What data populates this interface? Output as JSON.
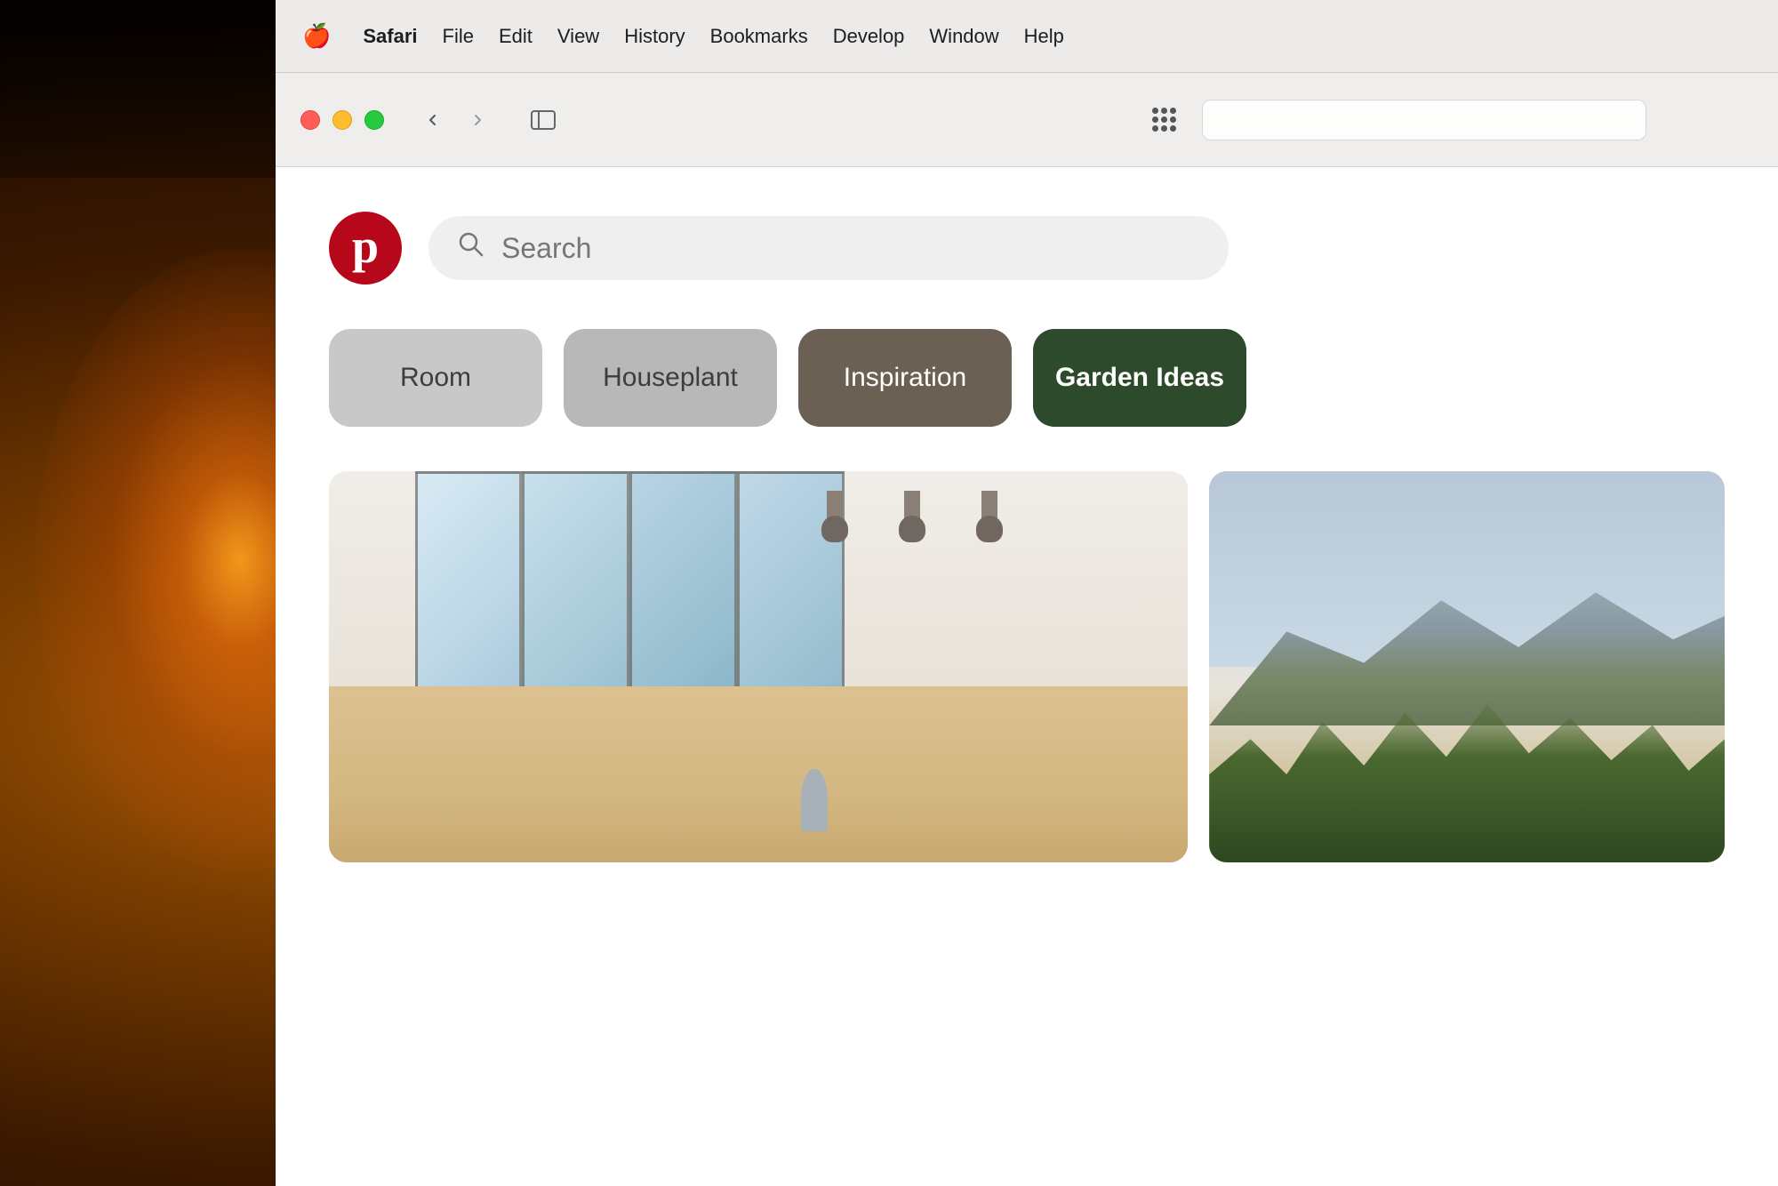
{
  "background": {
    "description": "Warm ambient photography background with glowing lamp"
  },
  "macos": {
    "menu_bar": {
      "apple_symbol": "🍎",
      "items": [
        {
          "label": "Safari",
          "bold": true
        },
        {
          "label": "File"
        },
        {
          "label": "Edit"
        },
        {
          "label": "View"
        },
        {
          "label": "History"
        },
        {
          "label": "Bookmarks"
        },
        {
          "label": "Develop"
        },
        {
          "label": "Window"
        },
        {
          "label": "Help"
        }
      ]
    },
    "browser_chrome": {
      "back_icon": "‹",
      "forward_icon": "›",
      "sidebar_icon": "sidebar",
      "grid_icon": "grid"
    }
  },
  "pinterest": {
    "logo_letter": "p",
    "logo_color": "#b7081b",
    "search": {
      "placeholder": "Search",
      "icon": "🔍"
    },
    "categories": [
      {
        "label": "Room",
        "style": "light-gray"
      },
      {
        "label": "Houseplant",
        "style": "medium-gray"
      },
      {
        "label": "Inspiration",
        "style": "dark-brown"
      },
      {
        "label": "Garden Ideas",
        "style": "dark-green"
      }
    ]
  }
}
